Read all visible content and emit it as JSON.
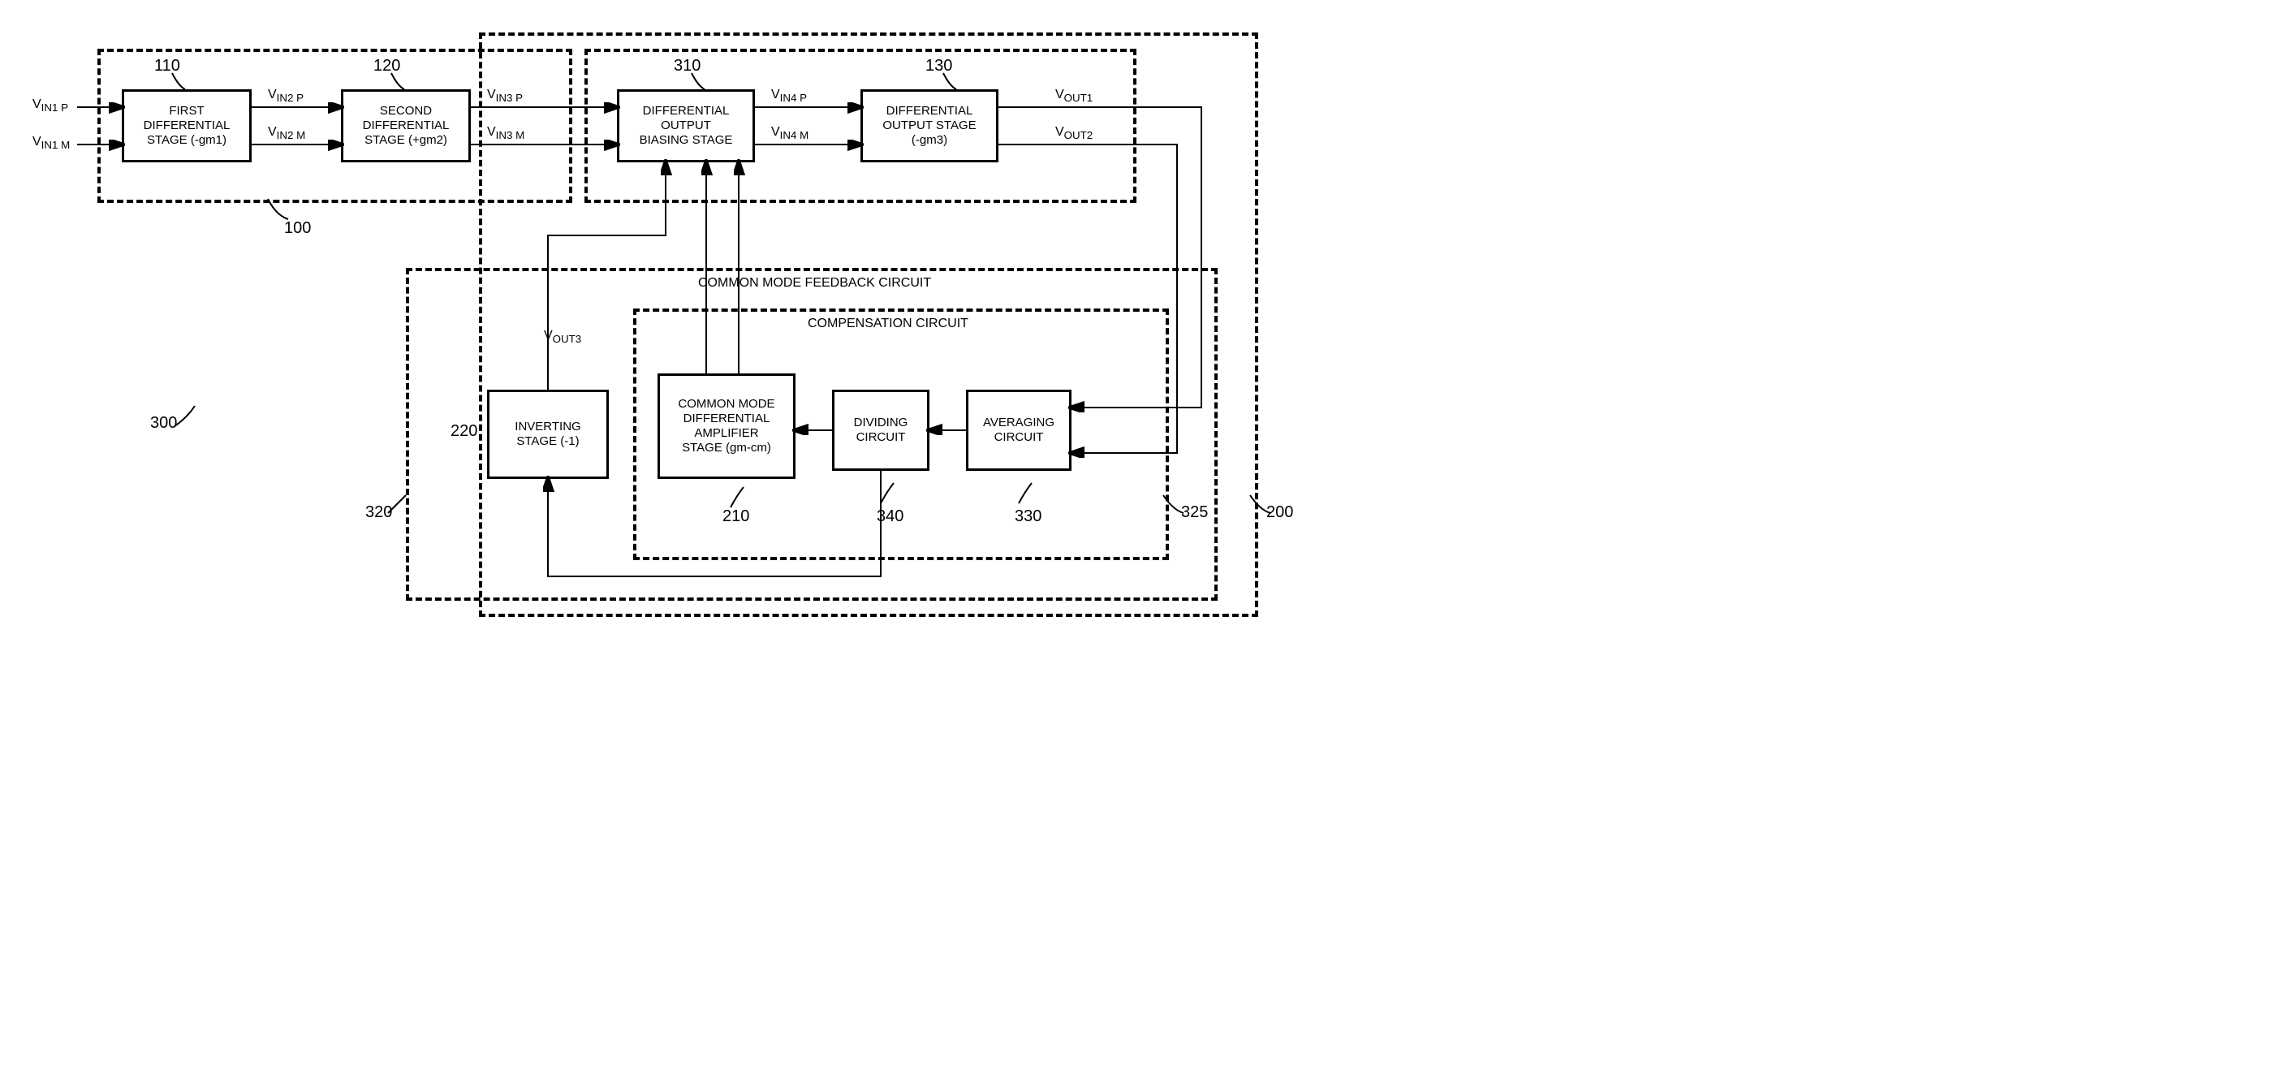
{
  "blocks": {
    "b110": "FIRST\nDIFFERENTIAL\nSTAGE (-gm1)",
    "b120": "SECOND\nDIFFERENTIAL\nSTAGE (+gm2)",
    "b310": "DIFFERENTIAL\nOUTPUT\nBIASING STAGE",
    "b130": "DIFFERENTIAL\nOUTPUT STAGE\n(-gm3)",
    "b220": "INVERTING\nSTAGE (-1)",
    "b210": "COMMON MODE\nDIFFERENTIAL\nAMPLIFIER\nSTAGE (gm-cm)",
    "b340": "DIVIDING\nCIRCUIT",
    "b330": "AVERAGING\nCIRCUIT"
  },
  "refs": {
    "r110": "110",
    "r120": "120",
    "r310": "310",
    "r130": "130",
    "r100": "100",
    "r300": "300",
    "r220": "220",
    "r320": "320",
    "r210": "210",
    "r340": "340",
    "r330": "330",
    "r325": "325",
    "r200": "200"
  },
  "signals": {
    "vin1p": "V",
    "vin1p_sub": "IN1 P",
    "vin1m": "V",
    "vin1m_sub": "IN1 M",
    "vin2p": "V",
    "vin2p_sub": "IN2 P",
    "vin2m": "V",
    "vin2m_sub": "IN2 M",
    "vin3p": "V",
    "vin3p_sub": "IN3 P",
    "vin3m": "V",
    "vin3m_sub": "IN3 M",
    "vin4p": "V",
    "vin4p_sub": "IN4 P",
    "vin4m": "V",
    "vin4m_sub": "IN4 M",
    "vout1": "V",
    "vout1_sub": "OUT1",
    "vout2": "V",
    "vout2_sub": "OUT2",
    "vout3": "V",
    "vout3_sub": "OUT3"
  },
  "labels": {
    "cmfeedback": "COMMON MODE FEEDBACK CIRCUIT",
    "compensation": "COMPENSATION CIRCUIT"
  }
}
